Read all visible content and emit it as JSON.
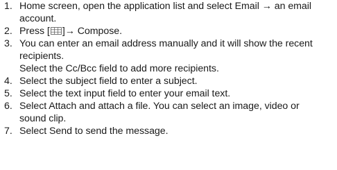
{
  "steps": [
    {
      "number": "1.",
      "lines": [
        "Home screen, open the application list and select Email → an email",
        "account."
      ]
    },
    {
      "number": "2.",
      "prefix": "Press [",
      "icon": "grid-menu-icon",
      "suffix": "]→ Compose."
    },
    {
      "number": "3.",
      "lines": [
        "You can enter an email address manually and it will show the recent",
        "recipients.",
        "Select the Cc/Bcc field to add more recipients."
      ]
    },
    {
      "number": "4.",
      "lines": [
        "Select the subject field to enter a subject."
      ]
    },
    {
      "number": "5.",
      "lines": [
        "Select the text input field to enter your email text."
      ]
    },
    {
      "number": "6.",
      "lines": [
        "Select Attach and attach a file. You can select an image, video or",
        "sound clip."
      ]
    },
    {
      "number": "7.",
      "lines": [
        "Select Send to send the message."
      ]
    }
  ]
}
